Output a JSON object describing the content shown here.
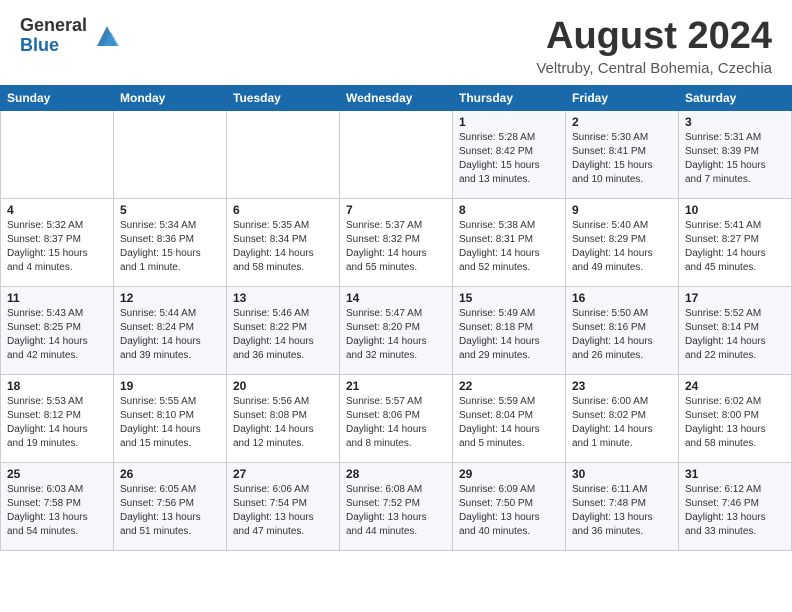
{
  "header": {
    "logo_general": "General",
    "logo_blue": "Blue",
    "month_year": "August 2024",
    "location": "Veltruby, Central Bohemia, Czechia"
  },
  "weekdays": [
    "Sunday",
    "Monday",
    "Tuesday",
    "Wednesday",
    "Thursday",
    "Friday",
    "Saturday"
  ],
  "weeks": [
    [
      {
        "day": "",
        "info": ""
      },
      {
        "day": "",
        "info": ""
      },
      {
        "day": "",
        "info": ""
      },
      {
        "day": "",
        "info": ""
      },
      {
        "day": "1",
        "info": "Sunrise: 5:28 AM\nSunset: 8:42 PM\nDaylight: 15 hours\nand 13 minutes."
      },
      {
        "day": "2",
        "info": "Sunrise: 5:30 AM\nSunset: 8:41 PM\nDaylight: 15 hours\nand 10 minutes."
      },
      {
        "day": "3",
        "info": "Sunrise: 5:31 AM\nSunset: 8:39 PM\nDaylight: 15 hours\nand 7 minutes."
      }
    ],
    [
      {
        "day": "4",
        "info": "Sunrise: 5:32 AM\nSunset: 8:37 PM\nDaylight: 15 hours\nand 4 minutes."
      },
      {
        "day": "5",
        "info": "Sunrise: 5:34 AM\nSunset: 8:36 PM\nDaylight: 15 hours\nand 1 minute."
      },
      {
        "day": "6",
        "info": "Sunrise: 5:35 AM\nSunset: 8:34 PM\nDaylight: 14 hours\nand 58 minutes."
      },
      {
        "day": "7",
        "info": "Sunrise: 5:37 AM\nSunset: 8:32 PM\nDaylight: 14 hours\nand 55 minutes."
      },
      {
        "day": "8",
        "info": "Sunrise: 5:38 AM\nSunset: 8:31 PM\nDaylight: 14 hours\nand 52 minutes."
      },
      {
        "day": "9",
        "info": "Sunrise: 5:40 AM\nSunset: 8:29 PM\nDaylight: 14 hours\nand 49 minutes."
      },
      {
        "day": "10",
        "info": "Sunrise: 5:41 AM\nSunset: 8:27 PM\nDaylight: 14 hours\nand 45 minutes."
      }
    ],
    [
      {
        "day": "11",
        "info": "Sunrise: 5:43 AM\nSunset: 8:25 PM\nDaylight: 14 hours\nand 42 minutes."
      },
      {
        "day": "12",
        "info": "Sunrise: 5:44 AM\nSunset: 8:24 PM\nDaylight: 14 hours\nand 39 minutes."
      },
      {
        "day": "13",
        "info": "Sunrise: 5:46 AM\nSunset: 8:22 PM\nDaylight: 14 hours\nand 36 minutes."
      },
      {
        "day": "14",
        "info": "Sunrise: 5:47 AM\nSunset: 8:20 PM\nDaylight: 14 hours\nand 32 minutes."
      },
      {
        "day": "15",
        "info": "Sunrise: 5:49 AM\nSunset: 8:18 PM\nDaylight: 14 hours\nand 29 minutes."
      },
      {
        "day": "16",
        "info": "Sunrise: 5:50 AM\nSunset: 8:16 PM\nDaylight: 14 hours\nand 26 minutes."
      },
      {
        "day": "17",
        "info": "Sunrise: 5:52 AM\nSunset: 8:14 PM\nDaylight: 14 hours\nand 22 minutes."
      }
    ],
    [
      {
        "day": "18",
        "info": "Sunrise: 5:53 AM\nSunset: 8:12 PM\nDaylight: 14 hours\nand 19 minutes."
      },
      {
        "day": "19",
        "info": "Sunrise: 5:55 AM\nSunset: 8:10 PM\nDaylight: 14 hours\nand 15 minutes."
      },
      {
        "day": "20",
        "info": "Sunrise: 5:56 AM\nSunset: 8:08 PM\nDaylight: 14 hours\nand 12 minutes."
      },
      {
        "day": "21",
        "info": "Sunrise: 5:57 AM\nSunset: 8:06 PM\nDaylight: 14 hours\nand 8 minutes."
      },
      {
        "day": "22",
        "info": "Sunrise: 5:59 AM\nSunset: 8:04 PM\nDaylight: 14 hours\nand 5 minutes."
      },
      {
        "day": "23",
        "info": "Sunrise: 6:00 AM\nSunset: 8:02 PM\nDaylight: 14 hours\nand 1 minute."
      },
      {
        "day": "24",
        "info": "Sunrise: 6:02 AM\nSunset: 8:00 PM\nDaylight: 13 hours\nand 58 minutes."
      }
    ],
    [
      {
        "day": "25",
        "info": "Sunrise: 6:03 AM\nSunset: 7:58 PM\nDaylight: 13 hours\nand 54 minutes."
      },
      {
        "day": "26",
        "info": "Sunrise: 6:05 AM\nSunset: 7:56 PM\nDaylight: 13 hours\nand 51 minutes."
      },
      {
        "day": "27",
        "info": "Sunrise: 6:06 AM\nSunset: 7:54 PM\nDaylight: 13 hours\nand 47 minutes."
      },
      {
        "day": "28",
        "info": "Sunrise: 6:08 AM\nSunset: 7:52 PM\nDaylight: 13 hours\nand 44 minutes."
      },
      {
        "day": "29",
        "info": "Sunrise: 6:09 AM\nSunset: 7:50 PM\nDaylight: 13 hours\nand 40 minutes."
      },
      {
        "day": "30",
        "info": "Sunrise: 6:11 AM\nSunset: 7:48 PM\nDaylight: 13 hours\nand 36 minutes."
      },
      {
        "day": "31",
        "info": "Sunrise: 6:12 AM\nSunset: 7:46 PM\nDaylight: 13 hours\nand 33 minutes."
      }
    ]
  ]
}
